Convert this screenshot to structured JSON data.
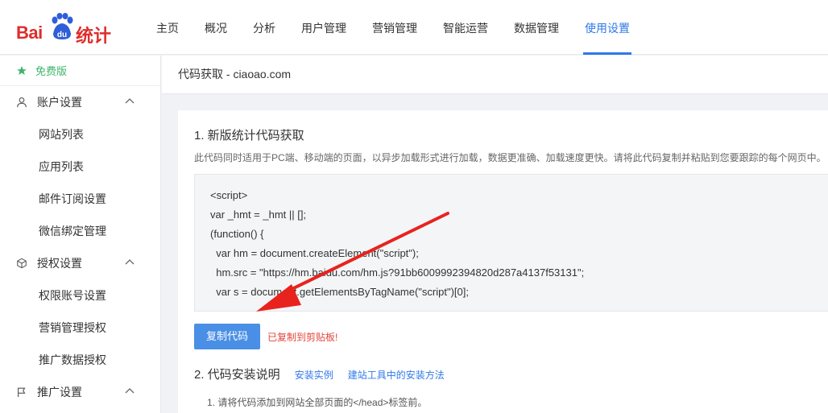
{
  "brand": {
    "logo_text_left": "Bai",
    "logo_text_mid": "du",
    "logo_text_right": "统计",
    "color": "#de2d2d"
  },
  "nav": {
    "items": [
      {
        "label": "主页",
        "active": false
      },
      {
        "label": "概况",
        "active": false
      },
      {
        "label": "分析",
        "active": false
      },
      {
        "label": "用户管理",
        "active": false
      },
      {
        "label": "营销管理",
        "active": false
      },
      {
        "label": "智能运营",
        "active": false
      },
      {
        "label": "数据管理",
        "active": false
      },
      {
        "label": "使用设置",
        "active": true
      }
    ],
    "accent": "#2f79e8"
  },
  "sidebar": {
    "free_label": "免费版",
    "groups": [
      {
        "label": "账户设置",
        "icon": "user-icon",
        "items": [
          "网站列表",
          "应用列表",
          "邮件订阅设置",
          "微信绑定管理"
        ]
      },
      {
        "label": "授权设置",
        "icon": "cube-icon",
        "items": [
          "权限账号设置",
          "营销管理授权",
          "推广数据授权"
        ]
      },
      {
        "label": "推广设置",
        "icon": "flag-icon",
        "items": []
      }
    ]
  },
  "main": {
    "breadcrumb": "代码获取 - ciaoao.com",
    "section1": {
      "title": "1. 新版统计代码获取",
      "desc": "此代码同时适用于PC端、移动端的页面，以异步加载形式进行加载，数据更准确、加载速度更快。请将此代码复制并粘贴到您要跟踪的每个网页中。",
      "code_lines": [
        "<script>",
        "var _hmt = _hmt || [];",
        "(function() {",
        "  var hm = document.createElement(\"script\");",
        "  hm.src = \"https://hm.baidu.com/hm.js?91bb6009992394820d287a4137f53131\";",
        "  var s = document.getElementsByTagName(\"script\")[0];"
      ],
      "copy_button": "复制代码",
      "copied_msg": "已复制到剪贴板!"
    },
    "section2": {
      "title": "2. 代码安装说明",
      "link1": "安装实例",
      "link2": "建站工具中的安装方法",
      "note": "1. 请将代码添加到网站全部页面的</head>标签前。"
    }
  },
  "annotation_arrow_color": "#e8231e"
}
